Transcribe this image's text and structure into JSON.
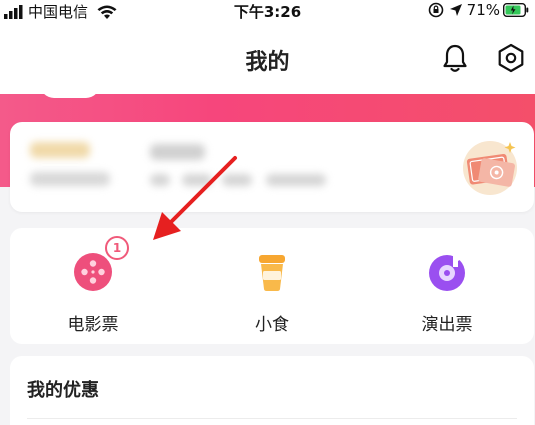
{
  "status_bar": {
    "carrier": "中国电信",
    "time": "下午3:26",
    "battery": "71%"
  },
  "header": {
    "title": "我的",
    "icons": [
      "bell-icon",
      "settings-icon"
    ]
  },
  "quick_actions": [
    {
      "label": "电影票",
      "icon": "movie-reel-icon",
      "badge": "1",
      "color": "#ee4f7c"
    },
    {
      "label": "小食",
      "icon": "drink-cup-icon",
      "color": "#f7a731"
    },
    {
      "label": "演出票",
      "icon": "music-disc-icon",
      "color": "#9a4ff0"
    }
  ],
  "coupons": {
    "title": "我的优惠"
  },
  "colors": {
    "accent_pink": "#f6467c",
    "annotation_arrow": "#e62020"
  }
}
